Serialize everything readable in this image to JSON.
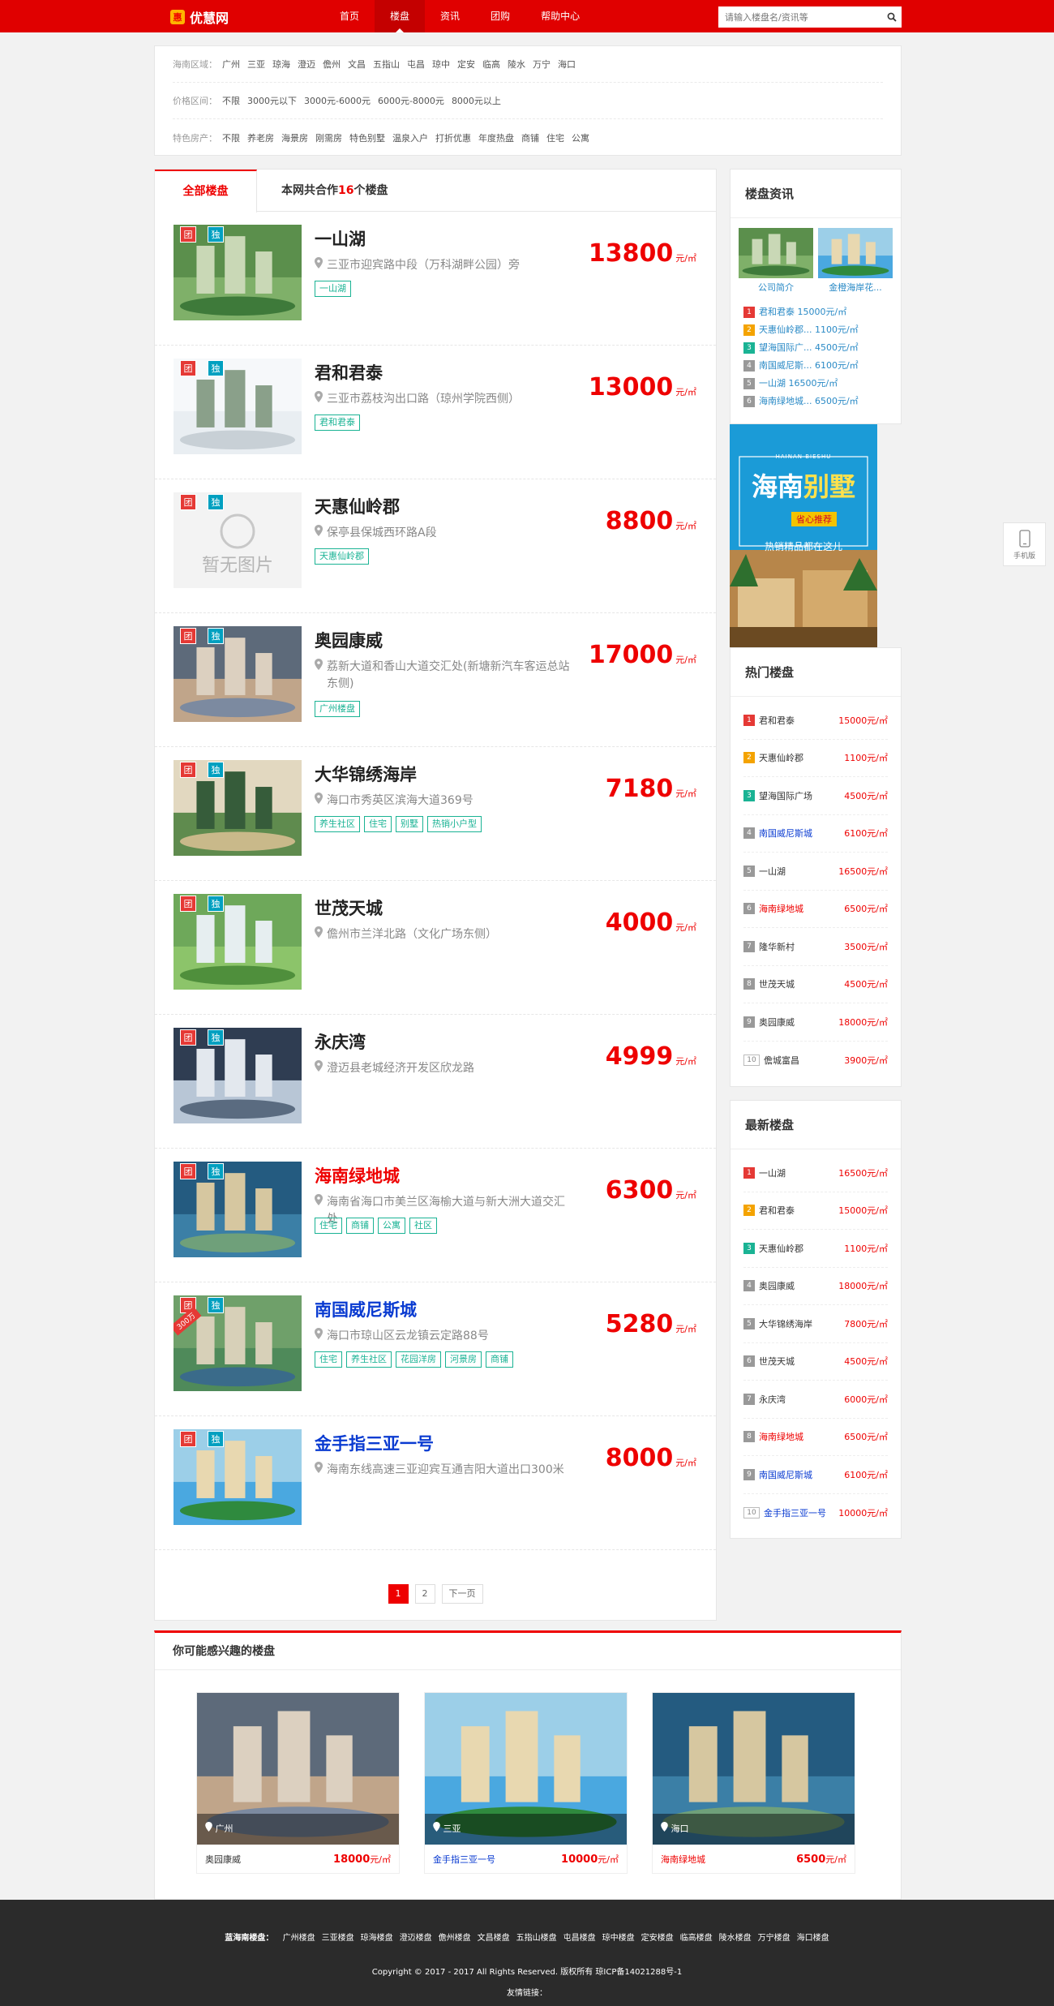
{
  "header": {
    "logo": "优慧网",
    "nav": [
      "首页",
      "楼盘",
      "资讯",
      "团购",
      "帮助中心"
    ],
    "active_nav": 1,
    "search_placeholder": "请输入楼盘名/资讯等"
  },
  "filter": {
    "region_label": "海南区域：",
    "regions": [
      "广州",
      "三亚",
      "琼海",
      "澄迈",
      "儋州",
      "文昌",
      "五指山",
      "屯昌",
      "琼中",
      "定安",
      "临高",
      "陵水",
      "万宁",
      "海口"
    ],
    "price_label": "价格区间：",
    "prices": [
      "不限",
      "3000元以下",
      "3000元-6000元",
      "6000元-8000元",
      "8000元以上"
    ],
    "feature_label": "特色房产：",
    "features": [
      "不限",
      "养老房",
      "海景房",
      "刚需房",
      "特色别墅",
      "温泉入户",
      "打折优惠",
      "年度热盘",
      "商铺",
      "住宅",
      "公寓"
    ]
  },
  "main": {
    "tab_all": "全部楼盘",
    "tab_count_prefix": "本网共合作",
    "tab_count": "16",
    "tab_count_suffix": "个楼盘",
    "unit": "元/㎡",
    "badge_tuan": "团",
    "badge_du": "独",
    "items": [
      {
        "name": "一山湖",
        "addr": "三亚市迎宾路中段（万科湖畔公园）旁",
        "tags": [
          "一山湖"
        ],
        "price": "13800",
        "name_color": "default",
        "img": "green"
      },
      {
        "name": "君和君泰",
        "addr": "三亚市荔枝沟出口路（琼州学院西侧）",
        "tags": [
          "君和君泰"
        ],
        "price": "13000",
        "name_color": "default",
        "img": "white"
      },
      {
        "name": "天惠仙岭郡",
        "addr": "保亭县保城西环路A段",
        "tags": [
          "天惠仙岭郡"
        ],
        "price": "8800",
        "name_color": "default",
        "img": "noimg",
        "noimg_text": "暂无图片"
      },
      {
        "name": "奥园康威",
        "addr": "荔新大道和香山大道交汇处(新塘新汽车客运总站东侧)",
        "tags": [
          "广州楼盘"
        ],
        "price": "17000",
        "name_color": "default",
        "img": "model"
      },
      {
        "name": "大华锦绣海岸",
        "addr": "海口市秀英区滨海大道369号",
        "tags": [
          "养生社区",
          "住宅",
          "别墅",
          "热销小户型"
        ],
        "price": "7180",
        "name_color": "default",
        "img": "aerial"
      },
      {
        "name": "世茂天城",
        "addr": "儋州市兰洋北路（文化广场东侧）",
        "tags": [],
        "price": "4000",
        "name_color": "default",
        "img": "green2"
      },
      {
        "name": "永庆湾",
        "addr": "澄迈县老城经济开发区欣龙路",
        "tags": [],
        "price": "4999",
        "name_color": "default",
        "img": "tower"
      },
      {
        "name": "海南绿地城",
        "addr": "海南省海口市美兰区海榆大道与新大洲大道交汇处",
        "tags": [
          "住宅",
          "商铺",
          "公寓",
          "社区"
        ],
        "price": "6300",
        "name_color": "red",
        "img": "coast"
      },
      {
        "name": "南国威尼斯城",
        "addr": "海口市琼山区云龙镇云定路88号",
        "tags": [
          "住宅",
          "养生社区",
          "花园洋房",
          "河景房",
          "商铺"
        ],
        "price": "5280",
        "name_color": "blue",
        "img": "venice",
        "ribbon": "300万"
      },
      {
        "name": "金手指三亚一号",
        "addr": "海南东线高速三亚迎宾互通吉阳大道出口300米",
        "tags": [],
        "price": "8000",
        "name_color": "blue",
        "img": "palm"
      }
    ],
    "pager": [
      "1",
      "2",
      "下一页"
    ]
  },
  "news": {
    "title": "楼盘资讯",
    "images": [
      {
        "caption": "公司简介"
      },
      {
        "caption": "金橙海岸花..."
      }
    ],
    "list": [
      "君和君泰 15000元/㎡",
      "天惠仙岭郡... 1100元/㎡",
      "望海国际广... 4500元/㎡",
      "南国威尼斯... 6100元/㎡",
      "一山湖 16500元/㎡",
      "海南绿地城... 6500元/㎡"
    ]
  },
  "ad": {
    "en": "HAINAN BIESHU",
    "line1": "海南",
    "line2": "别墅",
    "sub": "省心推荐",
    "desc": "热销精品都在这儿"
  },
  "mobile": {
    "label": "手机版"
  },
  "hot": {
    "title": "热门楼盘",
    "items": [
      {
        "name": "君和君泰",
        "price": "15000元/㎡",
        "color": "default"
      },
      {
        "name": "天惠仙岭郡",
        "price": "1100元/㎡",
        "color": "default"
      },
      {
        "name": "望海国际广场",
        "price": "4500元/㎡",
        "color": "default"
      },
      {
        "name": "南国威尼斯城",
        "price": "6100元/㎡",
        "color": "blue"
      },
      {
        "name": "一山湖",
        "price": "16500元/㎡",
        "color": "default"
      },
      {
        "name": "海南绿地城",
        "price": "6500元/㎡",
        "color": "red"
      },
      {
        "name": "隆华新村",
        "price": "3500元/㎡",
        "color": "default"
      },
      {
        "name": "世茂天城",
        "price": "4500元/㎡",
        "color": "default"
      },
      {
        "name": "奥园康威",
        "price": "18000元/㎡",
        "color": "default"
      },
      {
        "name": "儋城富昌",
        "price": "3900元/㎡",
        "color": "default"
      }
    ]
  },
  "latest": {
    "title": "最新楼盘",
    "items": [
      {
        "name": "一山湖",
        "price": "16500元/㎡",
        "color": "default"
      },
      {
        "name": "君和君泰",
        "price": "15000元/㎡",
        "color": "default"
      },
      {
        "name": "天惠仙岭郡",
        "price": "1100元/㎡",
        "color": "default"
      },
      {
        "name": "奥园康威",
        "price": "18000元/㎡",
        "color": "default"
      },
      {
        "name": "大华锦绣海岸",
        "price": "7800元/㎡",
        "color": "default"
      },
      {
        "name": "世茂天城",
        "price": "4500元/㎡",
        "color": "default"
      },
      {
        "name": "永庆湾",
        "price": "6000元/㎡",
        "color": "default"
      },
      {
        "name": "海南绿地城",
        "price": "6500元/㎡",
        "color": "red"
      },
      {
        "name": "南国威尼斯城",
        "price": "6100元/㎡",
        "color": "blue"
      },
      {
        "name": "金手指三亚一号",
        "price": "10000元/㎡",
        "color": "blue"
      }
    ]
  },
  "recommend": {
    "title": "你可能感兴趣的楼盘",
    "items": [
      {
        "loc": "广州",
        "name": "奥园康威",
        "price": "18000",
        "unit": "元/㎡",
        "name_color": "default",
        "img": "model"
      },
      {
        "loc": "三亚",
        "name": "金手指三亚一号",
        "price": "10000",
        "unit": "元/㎡",
        "name_color": "blue",
        "img": "palm"
      },
      {
        "loc": "海口",
        "name": "海南绿地城",
        "price": "6500",
        "unit": "元/㎡",
        "name_color": "red",
        "img": "coast"
      }
    ]
  },
  "footer": {
    "links_label": "蓝海南楼盘：",
    "links": [
      "广州楼盘",
      "三亚楼盘",
      "琼海楼盘",
      "澄迈楼盘",
      "儋州楼盘",
      "文昌楼盘",
      "五指山楼盘",
      "屯昌楼盘",
      "琼中楼盘",
      "定安楼盘",
      "临高楼盘",
      "陵水楼盘",
      "万宁楼盘",
      "海口楼盘"
    ],
    "copyright": "Copyright © 2017 - 2017 All Rights Reserved. 版权所有 琼ICP备14021288号-1",
    "friend": "友情链接："
  }
}
